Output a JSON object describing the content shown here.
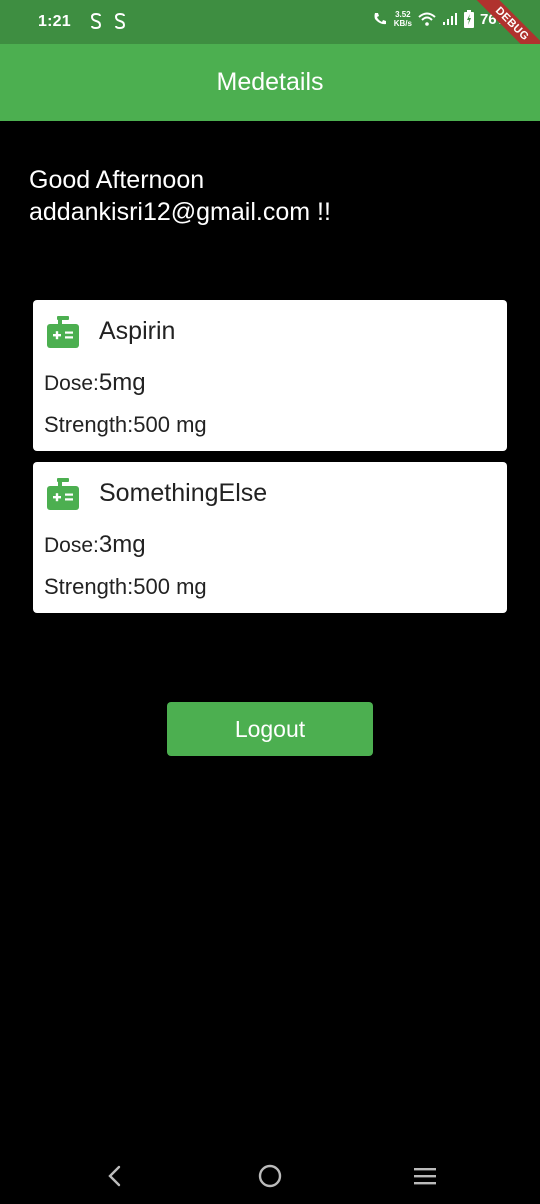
{
  "status_bar": {
    "time": "1:21",
    "net_speed_value": "3.52",
    "net_speed_unit": "KB/s",
    "battery": "76%",
    "debug_label": "DEBUG"
  },
  "app_bar": {
    "title": "Medetails"
  },
  "greeting": {
    "line1": "Good Afternoon",
    "line2": "addankisri12@gmail.com !!"
  },
  "medicines": [
    {
      "name": "Aspirin",
      "dose_label": "Dose:",
      "dose_value": "5mg",
      "strength_label": "Strength:",
      "strength_value": "500 mg"
    },
    {
      "name": "SomethingElse",
      "dose_label": "Dose:",
      "dose_value": "3mg",
      "strength_label": "Strength:",
      "strength_value": "500 mg"
    }
  ],
  "logout_label": "Logout",
  "colors": {
    "primary": "#4caf50",
    "status_bar": "#3e8e41",
    "background": "#000000",
    "card": "#ffffff",
    "debug_ribbon": "#b0322e"
  },
  "icons": {
    "medicine": "medical-kit-icon",
    "nav_back": "back-icon",
    "nav_home": "home-icon",
    "nav_recents": "recents-icon"
  }
}
